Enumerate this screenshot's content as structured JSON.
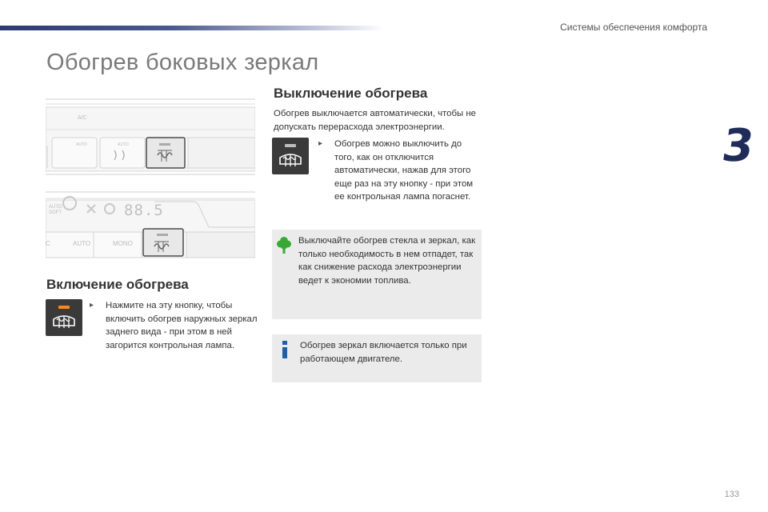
{
  "header": {
    "section_title": "Системы обеспечения комфорта",
    "chapter_number": "3",
    "page_number": "133"
  },
  "page_title": "Обогрев боковых зеркал",
  "illustration": {
    "top_panel": {
      "labels": [
        "A/C",
        "AUTO",
        "AUTO"
      ]
    },
    "bottom_panel": {
      "auto_soft_label": "AUTO SOFT",
      "temperature": "88.5",
      "button_labels": [
        "C",
        "AUTO",
        "MONO"
      ]
    }
  },
  "switch_on": {
    "heading": "Включение обогрева",
    "instruction": "Нажмите на эту кнопку, чтобы включить обогрев наружных зеркал заднего вида - при этом в ней загорится контрольная лампа.",
    "led_color": "#f08a24",
    "icon": "rear-window-defrost-icon"
  },
  "switch_off": {
    "heading": "Выключение обогрева",
    "intro": "Обогрев выключается автоматически, чтобы не допускать перерасхода электроэнергии.",
    "instruction": "Обогрев можно выключить до того, как он отключится автоматически, нажав для этого еще раз на эту кнопку - при этом ее контрольная лампа погаснет.",
    "led_color": "#bdbdbd",
    "icon": "rear-window-defrost-icon"
  },
  "eco_note": {
    "icon": "tree-icon",
    "icon_color": "#39a935",
    "text": "Выключайте обогрев стекла и зеркал, как только необходимость в нем отпадет, так как снижение расхода электроэнергии ведет к экономии топлива."
  },
  "info_note": {
    "icon": "info-icon",
    "icon_color": "#1f5fa8",
    "text": "Обогрев зеркал включается только при работающем двигателе."
  }
}
